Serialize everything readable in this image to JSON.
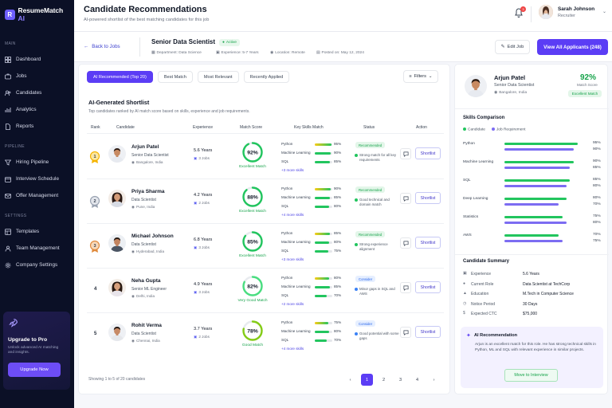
{
  "brand": {
    "name": "ResumeMatch",
    "suffix": " AI"
  },
  "sidebar": {
    "sections": [
      {
        "label": "MAIN",
        "items": [
          {
            "label": "Dashboard",
            "icon": "dashboard-icon"
          },
          {
            "label": "Jobs",
            "icon": "briefcase-icon"
          },
          {
            "label": "Candidates",
            "icon": "users-icon"
          },
          {
            "label": "Analytics",
            "icon": "chart-icon"
          },
          {
            "label": "Reports",
            "icon": "document-icon"
          }
        ]
      },
      {
        "label": "PIPELINE",
        "items": [
          {
            "label": "Hiring Pipeline",
            "icon": "pipeline-icon"
          },
          {
            "label": "Interview Schedule",
            "icon": "calendar-icon"
          },
          {
            "label": "Offer Management",
            "icon": "offer-icon"
          }
        ]
      },
      {
        "label": "SETTINGS",
        "items": [
          {
            "label": "Templates",
            "icon": "template-icon"
          },
          {
            "label": "Team Management",
            "icon": "team-icon"
          },
          {
            "label": "Company Settings",
            "icon": "gear-icon"
          }
        ]
      }
    ],
    "upgrade": {
      "title": "Upgrade to Pro",
      "desc": "Unlock advanced AI matching and insights.",
      "button": "Upgrade Now"
    }
  },
  "header": {
    "title": "Candidate Recommendations",
    "subtitle": "AI-powered shortlist of the best matching candidates for this job",
    "notifications": "3",
    "user": {
      "name": "Sarah Johnson",
      "role": "Recruiter"
    }
  },
  "job": {
    "back": "Back to Jobs",
    "title": "Senior Data Scientist",
    "status": "Active",
    "department": "Department: Data Science",
    "experience": "Experience: 5-7 Years",
    "location": "Location: Remote",
    "posted": "Posted on: May 12, 2024",
    "edit": "Edit Job",
    "view_all": "View All Applicants (248)"
  },
  "tabs": [
    "AI Recommended (Top 20)",
    "Best Match",
    "Most Relevant",
    "Recently Applied"
  ],
  "filters": "Filters",
  "shortlist": {
    "title": "AI-Generated Shortlist",
    "subtitle": "Top candidates ranked by AI match score based on skills, experience and job requirements.",
    "columns": [
      "Rank",
      "Candidate",
      "Experience",
      "Match Score",
      "Key Skills Match",
      "Status",
      "Action"
    ]
  },
  "candidates": [
    {
      "rank": "1",
      "name": "Arjun Patel",
      "role": "Senior Data Scientist",
      "location": "Bangalore, India",
      "years": "5.6 Years",
      "jobs": "3 Jobs",
      "score": 92,
      "score_text": "92%",
      "score_label": "Excellent Match",
      "skills": [
        {
          "name": "Python",
          "pct": 95,
          "text": "95%"
        },
        {
          "name": "Machine Learning",
          "pct": 90,
          "text": "90%"
        },
        {
          "name": "SQL",
          "pct": 85,
          "text": "85%"
        }
      ],
      "more": "+3 more skills",
      "status": "Recommended",
      "note": "Strong match for all key requirements"
    },
    {
      "rank": "2",
      "name": "Priya Sharma",
      "role": "Data Scientist",
      "location": "Pune, India",
      "years": "4.2 Years",
      "jobs": "2 Jobs",
      "score": 88,
      "score_text": "88%",
      "score_label": "Excellent Match",
      "skills": [
        {
          "name": "Python",
          "pct": 90,
          "text": "90%"
        },
        {
          "name": "Machine Learning",
          "pct": 85,
          "text": "85%"
        },
        {
          "name": "SQL",
          "pct": 80,
          "text": "80%"
        }
      ],
      "more": "+4 more skills",
      "status": "Recommended",
      "note": "Good technical and domain match"
    },
    {
      "rank": "3",
      "name": "Michael Johnson",
      "role": "Data Scientist",
      "location": "Hyderabad, India",
      "years": "6.8 Years",
      "jobs": "3 Jobs",
      "score": 85,
      "score_text": "85%",
      "score_label": "Excellent Match",
      "skills": [
        {
          "name": "Python",
          "pct": 85,
          "text": "85%"
        },
        {
          "name": "Machine Learning",
          "pct": 80,
          "text": "80%"
        },
        {
          "name": "SQL",
          "pct": 75,
          "text": "75%"
        }
      ],
      "more": "+3 more skills",
      "status": "Recommended",
      "note": "Strong experience alignment"
    },
    {
      "rank": "4",
      "name": "Neha Gupta",
      "role": "Senior ML Engineer",
      "location": "Delhi, India",
      "years": "4.9 Years",
      "jobs": "3 Jobs",
      "score": 82,
      "score_text": "82%",
      "score_label": "Very Good Match",
      "skills": [
        {
          "name": "Python",
          "pct": 80,
          "text": "80%"
        },
        {
          "name": "Machine Learning",
          "pct": 85,
          "text": "85%"
        },
        {
          "name": "SQL",
          "pct": 70,
          "text": "70%"
        }
      ],
      "more": "+2 more skills",
      "status": "Consider",
      "note": "Minor gaps in SQL and AWS"
    },
    {
      "rank": "5",
      "name": "Rohit Verma",
      "role": "Data Scientist",
      "location": "Chennai, India",
      "years": "3.7 Years",
      "jobs": "2 Jobs",
      "score": 78,
      "score_text": "78%",
      "score_label": "Good Match",
      "skills": [
        {
          "name": "Python",
          "pct": 75,
          "text": "75%"
        },
        {
          "name": "Machine Learning",
          "pct": 80,
          "text": "80%"
        },
        {
          "name": "SQL",
          "pct": 70,
          "text": "70%"
        }
      ],
      "more": "+4 more skills",
      "status": "Consider",
      "note": "Good potential with some gaps"
    }
  ],
  "action_label": "Shortlist",
  "pagination": {
    "showing": "Showing 1 to 5 of 20 candidates",
    "pages": [
      "1",
      "2",
      "3",
      "4"
    ],
    "active": "1"
  },
  "profile": {
    "name": "Arjun Patel",
    "role": "Senior Data Scientist",
    "location": "Bangalore, India",
    "score": "92%",
    "score_label": "Match Score",
    "badge": "Excellent Match",
    "comparison_title": "Skills Comparison",
    "legend": [
      "Candidate",
      "Job Requirement"
    ],
    "skills": [
      {
        "name": "Python",
        "candidate": 95,
        "requirement": 90,
        "text": "95%",
        "text2": "90%"
      },
      {
        "name": "Machine Learning",
        "candidate": 90,
        "requirement": 85,
        "text": "90%",
        "text2": "85%"
      },
      {
        "name": "SQL",
        "candidate": 85,
        "requirement": 80,
        "text": "85%",
        "text2": "80%"
      },
      {
        "name": "Deep Learning",
        "candidate": 80,
        "requirement": 70,
        "text": "80%",
        "text2": "70%"
      },
      {
        "name": "Statistics",
        "candidate": 75,
        "requirement": 80,
        "text": "75%",
        "text2": "80%"
      },
      {
        "name": "AWS",
        "candidate": 70,
        "requirement": 75,
        "text": "70%",
        "text2": "75%"
      }
    ],
    "summary_title": "Candidate Summary",
    "summary": [
      {
        "label": "Experience",
        "value": "5.6 Years"
      },
      {
        "label": "Current Role",
        "value": "Data Scientist at TechCorp"
      },
      {
        "label": "Education",
        "value": "M.Tech in Computer Science"
      },
      {
        "label": "Notice Period",
        "value": "30 Days"
      },
      {
        "label": "Expected CTC",
        "value": "$75,000"
      }
    ],
    "ai": {
      "title": "AI Recommendation",
      "text": "Arjun is an excellent match for this role. He has strong technical skills in Python, ML and SQL with relevant experience in similar projects.",
      "button": "Move to Interview"
    }
  },
  "colors": {
    "accent": "#5b3df5",
    "green": "#22c55e",
    "purple": "#7c6cf2",
    "navy": "#0b1026"
  }
}
